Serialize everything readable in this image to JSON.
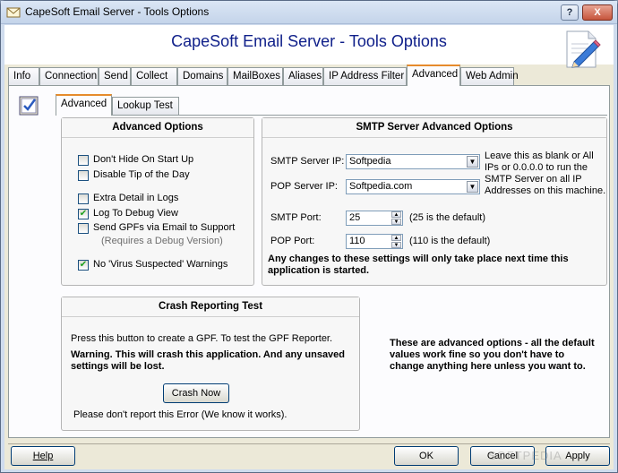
{
  "window": {
    "title": "CapeSoft Email Server - Tools Options",
    "help_glyph": "?",
    "close_glyph": "X"
  },
  "banner": {
    "title": "CapeSoft Email Server - Tools Options"
  },
  "main_tabs": [
    "Info",
    "Connection",
    "Send",
    "Collect",
    "Domains",
    "MailBoxes",
    "Aliases",
    "IP Address Filter",
    "Advanced",
    "Web Admin"
  ],
  "main_tabs_active": "Advanced",
  "sub_tabs": [
    "Advanced",
    "Lookup Test"
  ],
  "sub_tabs_active": "Advanced",
  "advanced_options": {
    "heading": "Advanced Options",
    "items": [
      {
        "label": "Don't Hide On Start Up",
        "checked": false
      },
      {
        "label": "Disable Tip of the Day",
        "checked": false
      },
      {
        "label": "Extra Detail in Logs",
        "checked": false
      },
      {
        "label": "Log To Debug View",
        "checked": true
      },
      {
        "label": "Send GPFs via Email to Support",
        "checked": false
      },
      {
        "label": "No 'Virus Suspected' Warnings",
        "checked": true
      }
    ],
    "debug_note": "(Requires a Debug Version)"
  },
  "smtp": {
    "heading": "SMTP Server Advanced Options",
    "server_ip_label": "SMTP Server IP:",
    "server_ip_value": "Softpedia",
    "pop_ip_label": "POP Server IP:",
    "pop_ip_value": "Softpedia.com",
    "ip_note": "Leave this as blank or All IPs or 0.0.0.0 to run the SMTP Server on all IP Addresses on this machine.",
    "smtp_port_label": "SMTP Port:",
    "smtp_port_value": "25",
    "smtp_port_note": "(25 is the default)",
    "pop_port_label": "POP Port:",
    "pop_port_value": "110",
    "pop_port_note": "(110 is the default)",
    "restart_note": "Any changes to these settings will only take place next time this application is started."
  },
  "crash": {
    "heading": "Crash Reporting Test",
    "intro": "Press this button to create a GPF. To test the GPF Reporter.",
    "warning": "Warning. This will crash this application. And any unsaved settings will be lost.",
    "button": "Crash Now",
    "footnote": "Please don't report this Error (We know it works)."
  },
  "advanced_info": "These are advanced options - all the default values work fine so you don't have to change anything here unless you want to.",
  "buttons": {
    "help": "Help",
    "ok": "OK",
    "cancel": "Cancel",
    "apply": "Apply"
  },
  "watermark": "SOFTPEDIA",
  "colors": {
    "banner_title": "#10208a",
    "tab_highlight": "#e68b2c",
    "check_mark": "#21a121"
  }
}
